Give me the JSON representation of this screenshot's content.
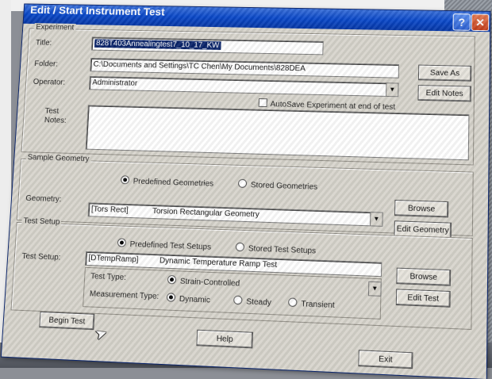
{
  "window": {
    "title": "Edit / Start Instrument Test",
    "help_glyph": "?",
    "close_glyph": "✕"
  },
  "experiment": {
    "group_label": "Experiment",
    "title_label": "Title:",
    "title_value": "828T403Annealingtest7_10_17_KW",
    "folder_label": "Folder:",
    "folder_value": "C:\\Documents and Settings\\TC Chen\\My Documents\\828DEA",
    "operator_label": "Operator:",
    "operator_value": "Administrator",
    "autosave_label": "AutoSave Experiment at end of test",
    "notes_label": "Test\nNotes:",
    "notes_value": "",
    "save_as_label": "Save As",
    "edit_notes_label": "Edit Notes"
  },
  "geometry": {
    "group_label": "Sample Geometry",
    "predefined_label": "Predefined Geometries",
    "stored_label": "Stored Geometries",
    "geometry_label": "Geometry:",
    "geometry_code": "[Tors Rect]",
    "geometry_name": "Torsion Rectangular Geometry",
    "browse_label": "Browse",
    "edit_geometry_label": "Edit Geometry"
  },
  "test_setup": {
    "group_label": "Test Setup",
    "predefined_label": "Predefined Test Setups",
    "stored_label": "Stored Test Setups",
    "setup_label": "Test Setup:",
    "setup_code": "[DTempRamp]",
    "setup_name": "Dynamic Temperature Ramp Test",
    "browse_label": "Browse",
    "edit_test_label": "Edit Test",
    "test_type_label": "Test Type:",
    "test_type_option": "Strain-Controlled",
    "measurement_type_label": "Measurement Type:",
    "measurement_options": [
      "Dynamic",
      "Steady",
      "Transient"
    ]
  },
  "footer": {
    "begin_test_label": "Begin Test",
    "help_label": "Help",
    "exit_label": "Exit"
  }
}
